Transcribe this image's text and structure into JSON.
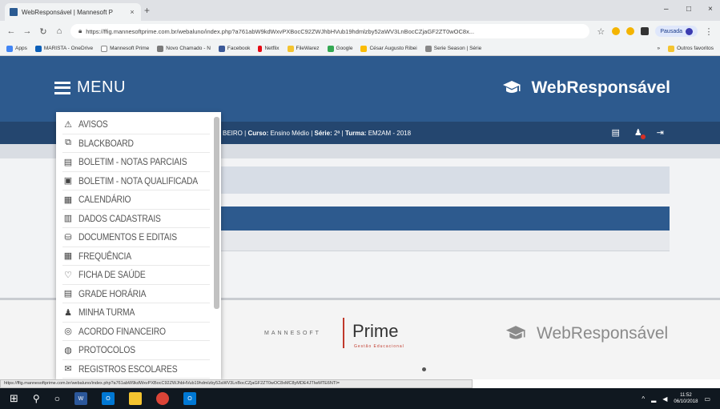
{
  "browser": {
    "tab_title": "WebResponsável | Mannesoft P",
    "tab_close": "×",
    "new_tab": "+",
    "window_controls": {
      "minimize": "–",
      "maximize": "□",
      "close": "×"
    },
    "url": "https://ffig.mannesoftprime.com.br/webaluno/index.php?a761abW9kdWxvPXBocC92ZWJhbHVub19hdmlzby52aWV3LnBocCZjaGF2ZT0wOC8x...",
    "bookmarks": [
      "Apps",
      "MARISTA - OneDrive",
      "Mannesoft Prime",
      "Novo Chamado - N",
      "Facebook",
      "Netflix",
      "FileWarez",
      "Google",
      "César Augusto Ribei",
      "Serie Season | Série"
    ],
    "bookmarks_right": [
      "»",
      "Outros favoritos"
    ],
    "profile_name": "Pausada"
  },
  "header": {
    "menu_label": "MENU",
    "brand_name": "WebResponsável"
  },
  "infobar": {
    "name_fragment": "BEIRO",
    "curso_label": "Curso:",
    "curso_value": "Ensino Médio",
    "serie_label": "Série:",
    "serie_value": "2ª",
    "turma_label": "Turma:",
    "turma_value": "EM2AM - 2018",
    "separator": "|"
  },
  "menu": {
    "items": [
      {
        "label": "AVISOS",
        "icon": "⚠"
      },
      {
        "label": "BLACKBOARD",
        "icon": "⧉"
      },
      {
        "label": "BOLETIM - NOTAS PARCIAIS",
        "icon": "▤"
      },
      {
        "label": "BOLETIM - NOTA QUALIFICADA",
        "icon": "▣"
      },
      {
        "label": "CALENDÁRIO",
        "icon": "▦"
      },
      {
        "label": "DADOS CADASTRAIS",
        "icon": "▥"
      },
      {
        "label": "DOCUMENTOS E EDITAIS",
        "icon": "⛁"
      },
      {
        "label": "FREQUÊNCIA",
        "icon": "▦"
      },
      {
        "label": "FICHA DE SAÚDE",
        "icon": "♡"
      },
      {
        "label": "GRADE HORÁRIA",
        "icon": "▤"
      },
      {
        "label": "MINHA TURMA",
        "icon": "♟"
      },
      {
        "label": "ACORDO FINANCEIRO",
        "icon": "◎"
      },
      {
        "label": "PROTOCOLOS",
        "icon": "◍"
      },
      {
        "label": "REGISTROS ESCOLARES",
        "icon": "✉"
      }
    ]
  },
  "footer": {
    "mannesoft": "MANNESOFT",
    "prime": "Prime",
    "prime_sub": "Gestão Educacional",
    "brand_name": "WebResponsável"
  },
  "statusbar": {
    "url": "https://ffig.mannesoftprime.com.br/webaluno/index.php?a761abW9kdWxvPXBocC92ZWJhbHVub19hdmlzby52aWV3LnBocCZjaGF2ZT0wOC8xMC8yMDE4JTIwMTE6NTI="
  },
  "taskbar": {
    "time": "11:52",
    "date": "06/10/2018"
  },
  "colors": {
    "header_blue": "#2d5a8e",
    "infobar_blue": "#24466f",
    "prime_red": "#c0392b"
  }
}
